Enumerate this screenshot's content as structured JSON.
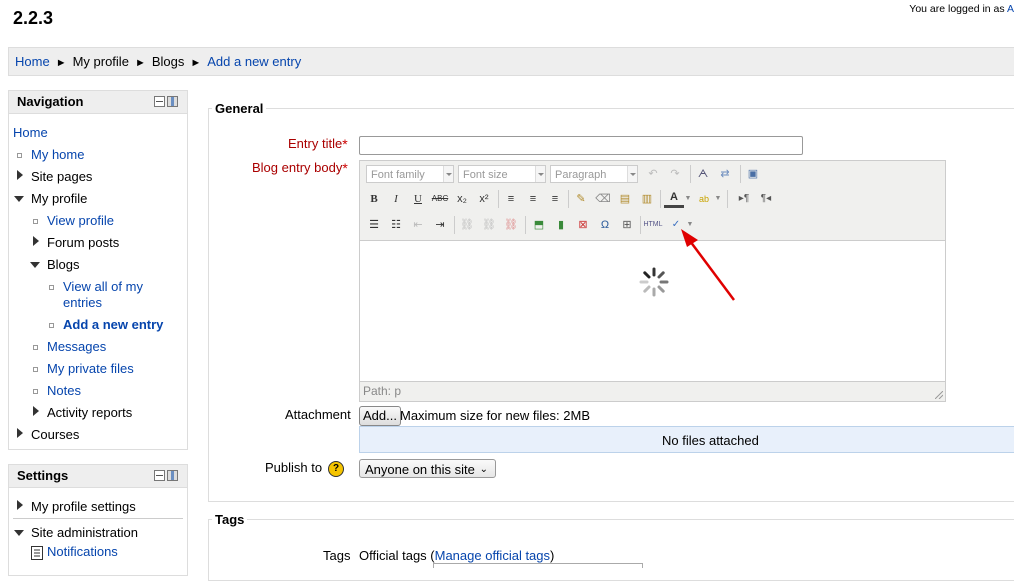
{
  "header": {
    "version": "2.2.3",
    "login_text": "You are logged in as",
    "login_user": "A"
  },
  "breadcrumb": {
    "items": [
      "Home",
      "My profile",
      "Blogs",
      "Add a new entry"
    ],
    "separator": "►"
  },
  "navigation": {
    "title": "Navigation",
    "items": {
      "home": "Home",
      "my_home": "My home",
      "site_pages": "Site pages",
      "my_profile": "My profile",
      "view_profile": "View profile",
      "forum_posts": "Forum posts",
      "blogs": "Blogs",
      "view_all_1": "View all of my",
      "view_all_2": "entries",
      "add_entry": "Add a new entry",
      "messages": "Messages",
      "private_files": "My private files",
      "notes": "Notes",
      "activity_reports": "Activity reports",
      "courses": "Courses"
    }
  },
  "settings": {
    "title": "Settings",
    "items": {
      "profile_settings": "My profile settings",
      "site_admin": "Site administration",
      "notifications": "Notifications"
    }
  },
  "form": {
    "general_legend": "General",
    "entry_title_label": "Entry title",
    "body_label": "Blog entry body",
    "required_mark": "*",
    "toolbar": {
      "font_family": "Font family",
      "font_size": "Font size",
      "paragraph": "Paragraph"
    },
    "path_text": "Path: p",
    "attachment_label": "Attachment",
    "add_button": "Add...",
    "max_size_text": "Maximum size for new files: 2MB",
    "no_files_text": "No files attached",
    "publish_label": "Publish to",
    "publish_value": "Anyone on this site",
    "tags_legend": "Tags",
    "tags_label": "Tags",
    "official_tags_prefix": "Official tags (",
    "manage_tags_link": "Manage official tags",
    "official_tags_suffix": ")"
  },
  "colors": {
    "link": "#0645ad",
    "required": "#aa0000",
    "annotation_arrow": "#e00000"
  }
}
